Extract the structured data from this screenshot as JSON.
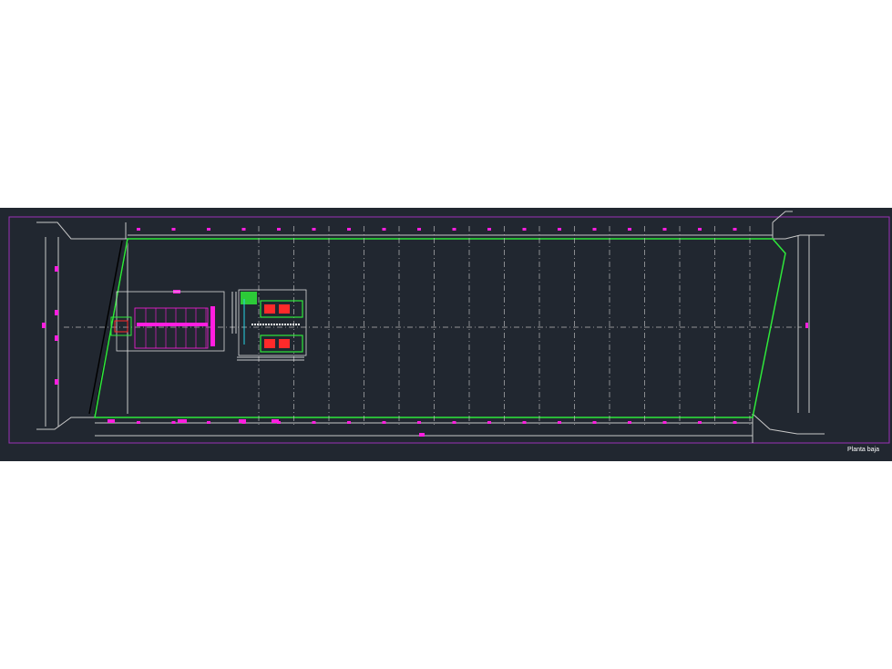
{
  "drawing": {
    "sheet_label": "Planta baja",
    "colors": {
      "background": "#212730",
      "page_background": "#ffffff",
      "frame": "#9b30b8",
      "perimeter": "#2ee83a",
      "lines": "#d9d9d9",
      "markers": "#ff1ee0",
      "accent_red": "#ff2a2a",
      "accent_cyan": "#27d6e6"
    }
  }
}
